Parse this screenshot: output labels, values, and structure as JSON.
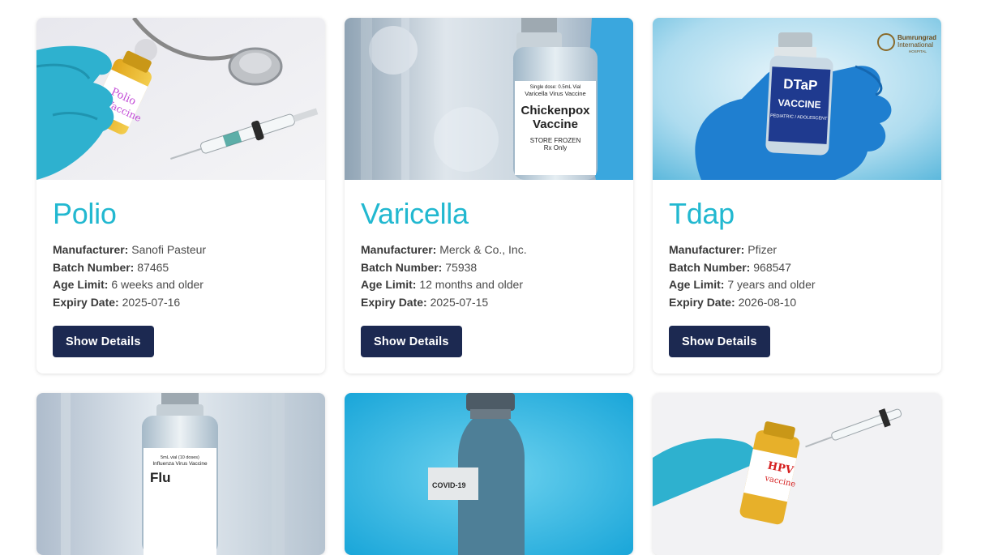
{
  "labels": {
    "manufacturer": "Manufacturer:",
    "batch": "Batch Number:",
    "age": "Age Limit:",
    "expiry": "Expiry Date:"
  },
  "cards": [
    {
      "name": "Polio",
      "manufacturer": "Sanofi Pasteur",
      "batch": "87465",
      "age": "6 weeks and older",
      "expiry": "2025-07-16",
      "button": "Show Details",
      "image_label_1": "Polio",
      "image_label_2": "Vaccine"
    },
    {
      "name": "Varicella",
      "manufacturer": "Merck & Co., Inc.",
      "batch": "75938",
      "age": "12 months and older",
      "expiry": "2025-07-15",
      "button": "Show Details",
      "image_label_small": "Single dose: 0.5mL Vial",
      "image_label_sub": "Varicella Virus Vaccine",
      "image_label_1": "Chickenpox",
      "image_label_2": "Vaccine",
      "image_label_3": "STORE FROZEN",
      "image_label_4": "Rx Only"
    },
    {
      "name": "Tdap",
      "manufacturer": "Pfizer",
      "batch": "968547",
      "age": "7 years and older",
      "expiry": "2026-08-10",
      "button": "Show Details",
      "image_label_1": "DTaP",
      "image_label_2": "VACCINE",
      "image_label_3": "PEDIATRIC / ADOLESCENT",
      "image_logo_1": "Bumrungrad",
      "image_logo_2": "International",
      "image_logo_3": "HOSPITAL"
    }
  ],
  "row2": [
    {
      "image_label_small": "5mL vial (10 doses)",
      "image_label_sub": "Influenza Virus Vaccine",
      "image_label_1": "Flu"
    },
    {
      "image_label_1": "COVID-19"
    },
    {
      "image_label_1": "HPV",
      "image_label_2": "vaccine"
    }
  ],
  "colors": {
    "accent": "#22b8d0",
    "button": "#1c2951"
  }
}
